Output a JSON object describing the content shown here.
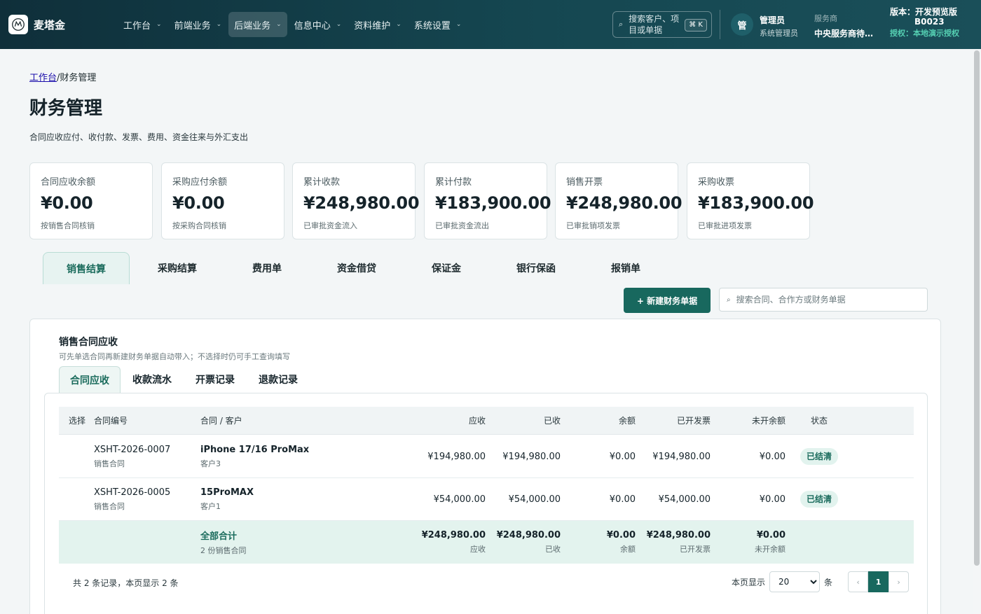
{
  "brand": {
    "name": "麦塔金"
  },
  "nav": [
    {
      "label": "工作台",
      "active": false
    },
    {
      "label": "前端业务",
      "active": false
    },
    {
      "label": "后端业务",
      "active": true
    },
    {
      "label": "信息中心",
      "active": false
    },
    {
      "label": "资料维护",
      "active": false
    },
    {
      "label": "系统设置",
      "active": false
    }
  ],
  "global_search": {
    "placeholder": "搜索客户、项目或单据",
    "shortcut": "⌘ K"
  },
  "user": {
    "avatar": "管",
    "name": "管理员",
    "role": "系统管理员"
  },
  "service": {
    "label": "服务商",
    "value": "中央服务商待…"
  },
  "version": {
    "line1": "版本：开发预览版",
    "line2": "B0023",
    "license_label": "授权：",
    "license_value": "本地演示授权"
  },
  "breadcrumb": {
    "home": "工作台",
    "sep": "/",
    "current": "财务管理"
  },
  "page": {
    "title": "财务管理",
    "subtitle": "合同应收应付、收付款、发票、费用、资金往来与外汇支出"
  },
  "stats": [
    {
      "label": "合同应收余额",
      "value": "¥0.00",
      "note": "按销售合同核销"
    },
    {
      "label": "采购应付余额",
      "value": "¥0.00",
      "note": "按采购合同核销"
    },
    {
      "label": "累计收款",
      "value": "¥248,980.00",
      "note": "已审批资金流入"
    },
    {
      "label": "累计付款",
      "value": "¥183,900.00",
      "note": "已审批资金流出"
    },
    {
      "label": "销售开票",
      "value": "¥248,980.00",
      "note": "已审批销项发票"
    },
    {
      "label": "采购收票",
      "value": "¥183,900.00",
      "note": "已审批进项发票"
    }
  ],
  "tabs": [
    {
      "label": "销售结算",
      "active": true
    },
    {
      "label": "采购结算",
      "active": false
    },
    {
      "label": "费用单",
      "active": false
    },
    {
      "label": "资金借贷",
      "active": false
    },
    {
      "label": "保证金",
      "active": false
    },
    {
      "label": "银行保函",
      "active": false
    },
    {
      "label": "报销单",
      "active": false
    }
  ],
  "toolbar": {
    "new_label": "+ 新建财务单据",
    "search_placeholder": "搜索合同、合作方或财务单据"
  },
  "panel": {
    "title": "销售合同应收",
    "desc": "可先单选合同再新建财务单据自动带入；不选择时仍可手工查询填写",
    "subtabs": [
      {
        "label": "合同应收",
        "active": true
      },
      {
        "label": "收款流水",
        "active": false
      },
      {
        "label": "开票记录",
        "active": false
      },
      {
        "label": "退款记录",
        "active": false
      }
    ]
  },
  "table": {
    "headers": {
      "select": "选择",
      "no": "合同编号",
      "contract": "合同 / 客户",
      "receivable": "应收",
      "received": "已收",
      "balance": "余额",
      "invoiced": "已开发票",
      "uninvoiced": "未开余额",
      "status": "状态"
    },
    "rows": [
      {
        "no": "XSHT-2026-0007",
        "no_type": "销售合同",
        "name": "iPhone 17/16 ProMax",
        "customer": "客户3",
        "receivable": "¥194,980.00",
        "received": "¥194,980.00",
        "balance": "¥0.00",
        "invoiced": "¥194,980.00",
        "uninvoiced": "¥0.00",
        "status": "已结清"
      },
      {
        "no": "XSHT-2026-0005",
        "no_type": "销售合同",
        "name": "15ProMAX",
        "customer": "客户1",
        "receivable": "¥54,000.00",
        "received": "¥54,000.00",
        "balance": "¥0.00",
        "invoiced": "¥54,000.00",
        "uninvoiced": "¥0.00",
        "status": "已结清"
      }
    ],
    "total": {
      "label": "全部合计",
      "count": "2 份销售合同",
      "receivable": "¥248,980.00",
      "receivable_sub": "应收",
      "received": "¥248,980.00",
      "received_sub": "已收",
      "balance": "¥0.00",
      "balance_sub": "余额",
      "invoiced": "¥248,980.00",
      "invoiced_sub": "已开发票",
      "uninvoiced": "¥0.00",
      "uninvoiced_sub": "未开余额"
    }
  },
  "pager": {
    "info": "共 2 条记录，本页显示 2 条",
    "per_page_label": "本页显示",
    "per_page": "20",
    "unit": "条",
    "prev": "‹",
    "current": "1",
    "next": "›"
  }
}
